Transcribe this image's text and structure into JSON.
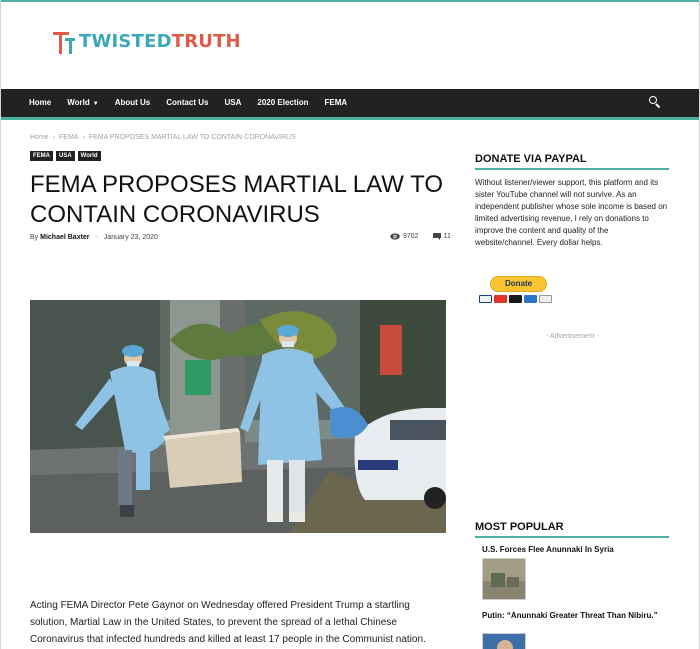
{
  "site": {
    "logo_part1": "TWISTED",
    "logo_part2": "TRUTH"
  },
  "nav": {
    "items": [
      {
        "label": "Home"
      },
      {
        "label": "World",
        "has_dropdown": true
      },
      {
        "label": "About Us"
      },
      {
        "label": "Contact Us"
      },
      {
        "label": "USA"
      },
      {
        "label": "2020 Election"
      },
      {
        "label": "FEMA"
      }
    ],
    "search_icon": "search-icon"
  },
  "breadcrumb": {
    "items": [
      "Home",
      "FEMA",
      "FEMA PROPOSES MARTIAL LAW TO CONTAIN CORONAVIRUS"
    ],
    "separator": "›"
  },
  "article": {
    "tags": [
      "FEMA",
      "USA",
      "World"
    ],
    "title": "FEMA PROPOSES MARTIAL LAW TO CONTAIN CORONAVIRUS",
    "by": "By",
    "author": "Michael Baxter",
    "date": "January 23, 2020",
    "views": "9702",
    "comments": "11",
    "body": "Acting FEMA Director Pete Gaynor on Wednesday offered President Trump a startling solution, Martial Law in the United States, to prevent the spread of a lethal Chinese Coronavirus that infected hundreds and killed at least 17 people in the Communist nation."
  },
  "sidebar": {
    "paypal_heading": "DONATE VIA PAYPAL",
    "paypal_text": "Without listener/viewer support, this platform and its sister YouTube channel will not survive. As an independent publisher whose sole income is based on limited advertising revenue, I rely on donations to improve the content and quality of the website/channel. Every dollar helps.",
    "donate_label": "Donate",
    "advertisement_label": "- Advertisement -",
    "popular_heading": "MOST POPULAR",
    "popular": [
      {
        "title": "U.S. Forces Flee Anunnaki In Syria"
      },
      {
        "title": "Putin: “Anunnaki Greater Threat Than Nibiru.”"
      }
    ]
  },
  "colors": {
    "accent": "#4db2a3",
    "logo_teal": "#3aa9b8",
    "logo_red": "#e05a47",
    "nav_bg": "#222222",
    "donate_yellow": "#fbc532"
  }
}
